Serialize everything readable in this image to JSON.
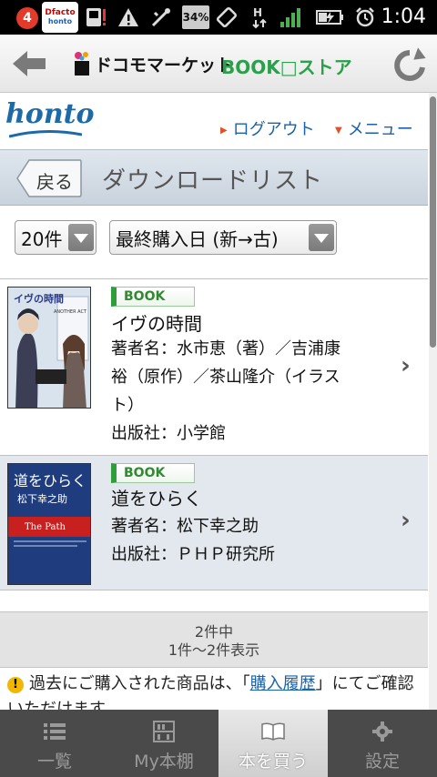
{
  "statusbar": {
    "notification_count": "4",
    "dfacto_label": "Dfacto",
    "dfacto_sub": "honto",
    "battery": "34%",
    "time": "1:04"
  },
  "header": {
    "store_name": "ドコモマーケット",
    "book_store": "BOOK□ストア"
  },
  "honto": {
    "logo": "honto",
    "logout": "ログアウト",
    "menu": "メニュー"
  },
  "titlebar": {
    "back_label": "戻る",
    "title": "ダウンロードリスト"
  },
  "filters": {
    "count_value": "20件",
    "sort_value": "最終購入日 (新→古)"
  },
  "items": [
    {
      "badge": "BOOK",
      "title": "イヴの時間",
      "author_lines": [
        "著者名：水市恵（著）／吉浦康",
        "裕（原作）／茶山隆介（イラス",
        "ト）"
      ],
      "publisher": "出版社：小学館",
      "cover_title": "イヴの時間",
      "cover_sub": "ANOTHER ACT"
    },
    {
      "badge": "BOOK",
      "title": "道をひらく",
      "author_lines": [
        "著者名：松下幸之助"
      ],
      "publisher": "出版社：ＰＨＰ研究所",
      "cover_title": "道をひらく",
      "cover_author": "松下幸之助",
      "cover_en": "The Path"
    }
  ],
  "summary": {
    "total": "2件中",
    "range": "1件〜2件表示"
  },
  "notice": {
    "text_before": "過去にご購入された商品は、「",
    "link": "購入履歴",
    "text_after": "」にてご確認いただけます。"
  },
  "tabs": [
    {
      "label": "一覧",
      "icon": "list-icon"
    },
    {
      "label": "My本棚",
      "icon": "bookshelf-icon"
    },
    {
      "label": "本を買う",
      "icon": "open-book-icon"
    },
    {
      "label": "設定",
      "icon": "gear-icon"
    }
  ],
  "colors": {
    "accent_blue": "#1a63a8",
    "book_green": "#2aa04a",
    "list_alt_bg": "#e3e8ef"
  }
}
